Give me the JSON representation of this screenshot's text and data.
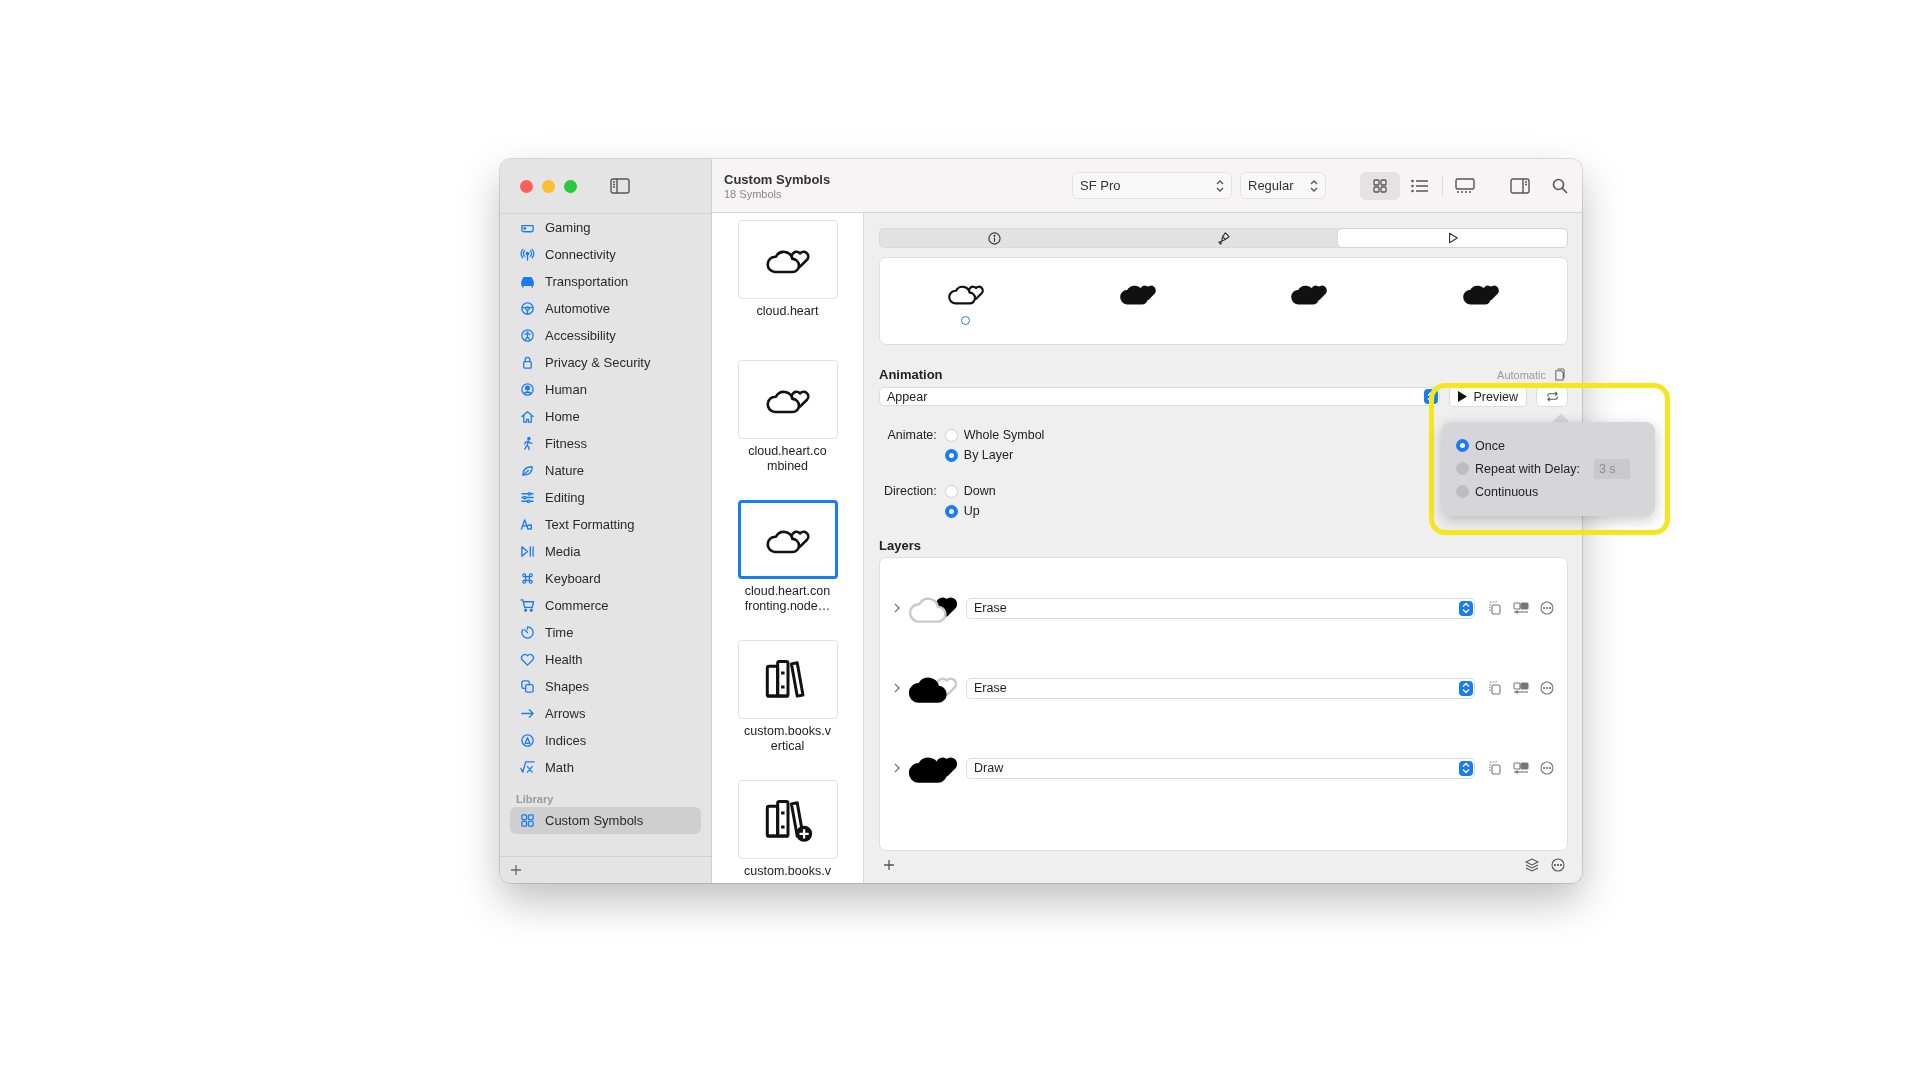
{
  "window": {
    "title": "Custom Symbols",
    "subtitle": "18 Symbols"
  },
  "toolbar": {
    "font": "SF Pro",
    "weight": "Regular",
    "view_modes": [
      {
        "kind": "grid",
        "selected": true
      },
      {
        "kind": "list",
        "selected": false
      },
      {
        "kind": "gallery",
        "selected": false
      }
    ]
  },
  "sidebar": {
    "items": [
      {
        "label": "Gaming",
        "selected": false
      },
      {
        "label": "Connectivity",
        "selected": false
      },
      {
        "label": "Transportation",
        "selected": false
      },
      {
        "label": "Automotive",
        "selected": false
      },
      {
        "label": "Accessibility",
        "selected": false
      },
      {
        "label": "Privacy & Security",
        "selected": false
      },
      {
        "label": "Human",
        "selected": false
      },
      {
        "label": "Home",
        "selected": false
      },
      {
        "label": "Fitness",
        "selected": false
      },
      {
        "label": "Nature",
        "selected": false
      },
      {
        "label": "Editing",
        "selected": false
      },
      {
        "label": "Text Formatting",
        "selected": false
      },
      {
        "label": "Media",
        "selected": false
      },
      {
        "label": "Keyboard",
        "selected": false
      },
      {
        "label": "Commerce",
        "selected": false
      },
      {
        "label": "Time",
        "selected": false
      },
      {
        "label": "Health",
        "selected": false
      },
      {
        "label": "Shapes",
        "selected": false
      },
      {
        "label": "Arrows",
        "selected": false
      },
      {
        "label": "Indices",
        "selected": false
      },
      {
        "label": "Math",
        "selected": false
      }
    ],
    "library_heading": "Library",
    "library_items": [
      {
        "label": "Custom Symbols",
        "selected": true
      }
    ]
  },
  "symbols": [
    {
      "name": "cloud.heart",
      "kind": "cloud-heart",
      "selected": false
    },
    {
      "name": "cloud.heart.combined",
      "kind": "cloud-heart",
      "selected": false
    },
    {
      "name": "cloud.heart.confronting.node…",
      "kind": "cloud-heart",
      "selected": true
    },
    {
      "name": "custom.books.vertical",
      "kind": "books",
      "selected": false
    },
    {
      "name": "custom.books.v",
      "kind": "books-plus",
      "selected": false
    }
  ],
  "inspector": {
    "tabs": [
      {
        "kind": "info",
        "selected": false
      },
      {
        "kind": "brush",
        "selected": false
      },
      {
        "kind": "play",
        "selected": true
      }
    ],
    "frames": [
      {
        "kind": "outline",
        "selected": true
      },
      {
        "kind": "filled",
        "selected": false
      },
      {
        "kind": "filled",
        "selected": false
      },
      {
        "kind": "filled",
        "selected": false
      }
    ],
    "animation": {
      "heading": "Animation",
      "mode": "Automatic",
      "effect": "Appear",
      "preview_button": "Preview",
      "animate_label": "Animate:",
      "animate_options": [
        {
          "label": "Whole Symbol",
          "selected": false
        },
        {
          "label": "By Layer",
          "selected": true
        }
      ],
      "direction_label": "Direction:",
      "direction_options": [
        {
          "label": "Down",
          "selected": false
        },
        {
          "label": "Up",
          "selected": true
        }
      ]
    },
    "layers": {
      "heading": "Layers",
      "rows": [
        {
          "kind": "heart",
          "behavior": "Erase"
        },
        {
          "kind": "cloud",
          "behavior": "Erase"
        },
        {
          "kind": "all",
          "behavior": "Draw"
        }
      ]
    }
  },
  "playback_popover": {
    "options": [
      {
        "label": "Once",
        "selected": true
      },
      {
        "label": "Repeat with Delay:",
        "selected": false
      },
      {
        "label": "Continuous",
        "selected": false
      }
    ],
    "delay": "3 s"
  }
}
